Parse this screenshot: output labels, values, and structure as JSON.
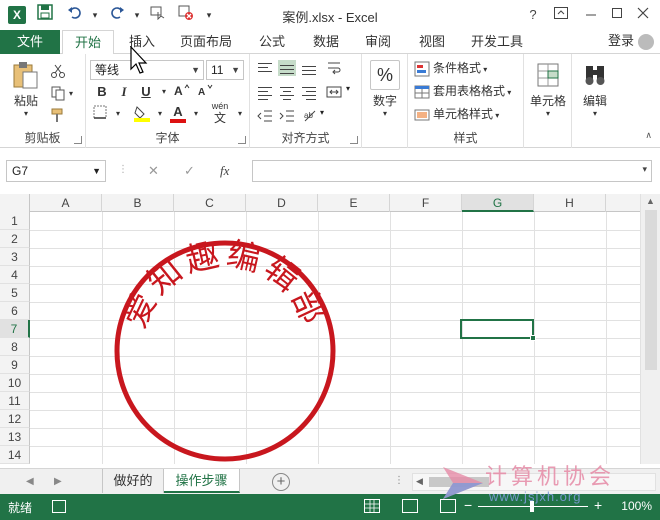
{
  "window": {
    "app_logo": "X",
    "title": "案例.xlsx - Excel",
    "help": "?",
    "controls": [
      "ribbon-display",
      "minimize",
      "maximize",
      "close"
    ]
  },
  "quick_access": {
    "icons": [
      "save-icon",
      "undo-icon",
      "redo-icon",
      "touch-mode-icon",
      "clear-format-icon",
      "customize-icon"
    ]
  },
  "tabs": {
    "file": "文件",
    "items": [
      "开始",
      "插入",
      "页面布局",
      "公式",
      "数据",
      "审阅",
      "视图",
      "开发工具"
    ],
    "active": "开始",
    "login": "登录"
  },
  "ribbon": {
    "clipboard": {
      "label": "剪贴板",
      "paste": "粘贴"
    },
    "font": {
      "label": "字体",
      "font_name": "等线",
      "font_size": "11",
      "bold": "B",
      "italic": "I",
      "underline": "U",
      "font_color_letter": "A",
      "phonetic": "wén"
    },
    "alignment": {
      "label": "对齐方式"
    },
    "number": {
      "label": "数字",
      "percent": "%"
    },
    "styles": {
      "label": "样式",
      "conditional": "条件格式",
      "table_format": "套用表格格式",
      "cell_styles": "单元格样式"
    },
    "cells": {
      "label": "单元格"
    },
    "editing": {
      "label": "编辑"
    }
  },
  "formula_bar": {
    "name_box": "G7",
    "fx": "fx",
    "content": ""
  },
  "sheet": {
    "columns": [
      "A",
      "B",
      "C",
      "D",
      "E",
      "F",
      "G",
      "H"
    ],
    "rows": [
      "1",
      "2",
      "3",
      "4",
      "5",
      "6",
      "7",
      "8",
      "9",
      "10",
      "11",
      "12",
      "13",
      "14"
    ],
    "selected_column": "G",
    "selected_row": "7"
  },
  "stamp": {
    "text": "爱知趣编辑部",
    "color": "#c8171e"
  },
  "sheet_tabs": {
    "items": [
      "做好的",
      "操作步骤"
    ],
    "active": "操作步骤"
  },
  "statusbar": {
    "ready": "就绪",
    "zoom": "100%",
    "zoom_minus": "−",
    "zoom_plus": "+"
  },
  "watermark": {
    "title": "计算机协会",
    "url": "www.jsjxh.org"
  },
  "colors": {
    "accent": "#217346",
    "stamp_red": "#c8171e"
  }
}
